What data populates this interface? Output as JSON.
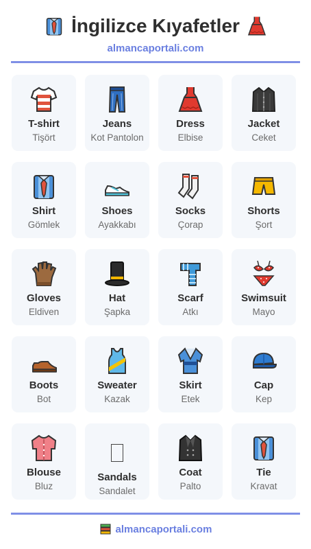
{
  "header": {
    "title": "İngilizce Kıyafetler",
    "title_left_icon": "shirt-with-tie-icon",
    "title_right_icon": "dress-icon",
    "site": "almancaportali.com"
  },
  "items": [
    {
      "en": "T-shirt",
      "tr": "Tişört",
      "icon": "tshirt-icon"
    },
    {
      "en": "Jeans",
      "tr": "Kot Pantolon",
      "icon": "jeans-icon"
    },
    {
      "en": "Dress",
      "tr": "Elbise",
      "icon": "dress-icon"
    },
    {
      "en": "Jacket",
      "tr": "Ceket",
      "icon": "jacket-icon"
    },
    {
      "en": "Shirt",
      "tr": "Gömlek",
      "icon": "shirt-icon"
    },
    {
      "en": "Shoes",
      "tr": "Ayakkabı",
      "icon": "sneaker-icon"
    },
    {
      "en": "Socks",
      "tr": "Çorap",
      "icon": "socks-icon"
    },
    {
      "en": "Shorts",
      "tr": "Şort",
      "icon": "shorts-icon"
    },
    {
      "en": "Gloves",
      "tr": "Eldiven",
      "icon": "gloves-icon"
    },
    {
      "en": "Hat",
      "tr": "Şapka",
      "icon": "top-hat-icon"
    },
    {
      "en": "Scarf",
      "tr": "Atkı",
      "icon": "scarf-icon"
    },
    {
      "en": "Swimsuit",
      "tr": "Mayo",
      "icon": "bikini-icon"
    },
    {
      "en": "Boots",
      "tr": "Bot",
      "icon": "boot-icon"
    },
    {
      "en": "Sweater",
      "tr": "Kazak",
      "icon": "tank-top-icon"
    },
    {
      "en": "Skirt",
      "tr": "Etek",
      "icon": "kimono-icon"
    },
    {
      "en": "Cap",
      "tr": "Kep",
      "icon": "cap-icon"
    },
    {
      "en": "Blouse",
      "tr": "Bluz",
      "icon": "blouse-icon"
    },
    {
      "en": "Sandals",
      "tr": "Sandalet",
      "icon": "missing-glyph-icon"
    },
    {
      "en": "Coat",
      "tr": "Palto",
      "icon": "coat-icon"
    },
    {
      "en": "Tie",
      "tr": "Kravat",
      "icon": "shirt-with-tie-icon"
    }
  ],
  "footer": {
    "icon": "books-icon",
    "site": "almancaportali.com"
  },
  "colors": {
    "accent": "#6a7fe0",
    "rule": "#7f8fe6",
    "card_bg": "#f4f7fb"
  }
}
